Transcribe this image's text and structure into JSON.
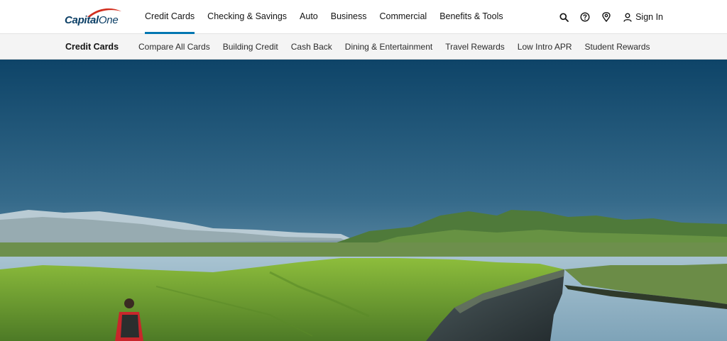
{
  "brand": {
    "logo_text_a": "Capital",
    "logo_text_b": "One"
  },
  "main_nav": [
    {
      "label": "Credit Cards",
      "active": true
    },
    {
      "label": "Checking & Savings",
      "active": false
    },
    {
      "label": "Auto",
      "active": false
    },
    {
      "label": "Business",
      "active": false
    },
    {
      "label": "Commercial",
      "active": false
    },
    {
      "label": "Benefits & Tools",
      "active": false
    }
  ],
  "utilities": {
    "icons": [
      "search-icon",
      "help-icon",
      "location-icon"
    ],
    "sign_in_label": "Sign In"
  },
  "sub_nav": {
    "title": "Credit Cards",
    "items": [
      "Compare All Cards",
      "Building Credit",
      "Cash Back",
      "Dining & Entertainment",
      "Travel Rewards",
      "Low Intro APR",
      "Student Rewards"
    ]
  },
  "colors": {
    "brand_blue": "#0c3f66",
    "brand_red": "#d22e1e",
    "active_underline": "#0276b1",
    "sky_top": "#0e4468",
    "sky_bottom": "#7aa0b6",
    "grass": "#6ea332",
    "water": "#8fb2c6"
  }
}
